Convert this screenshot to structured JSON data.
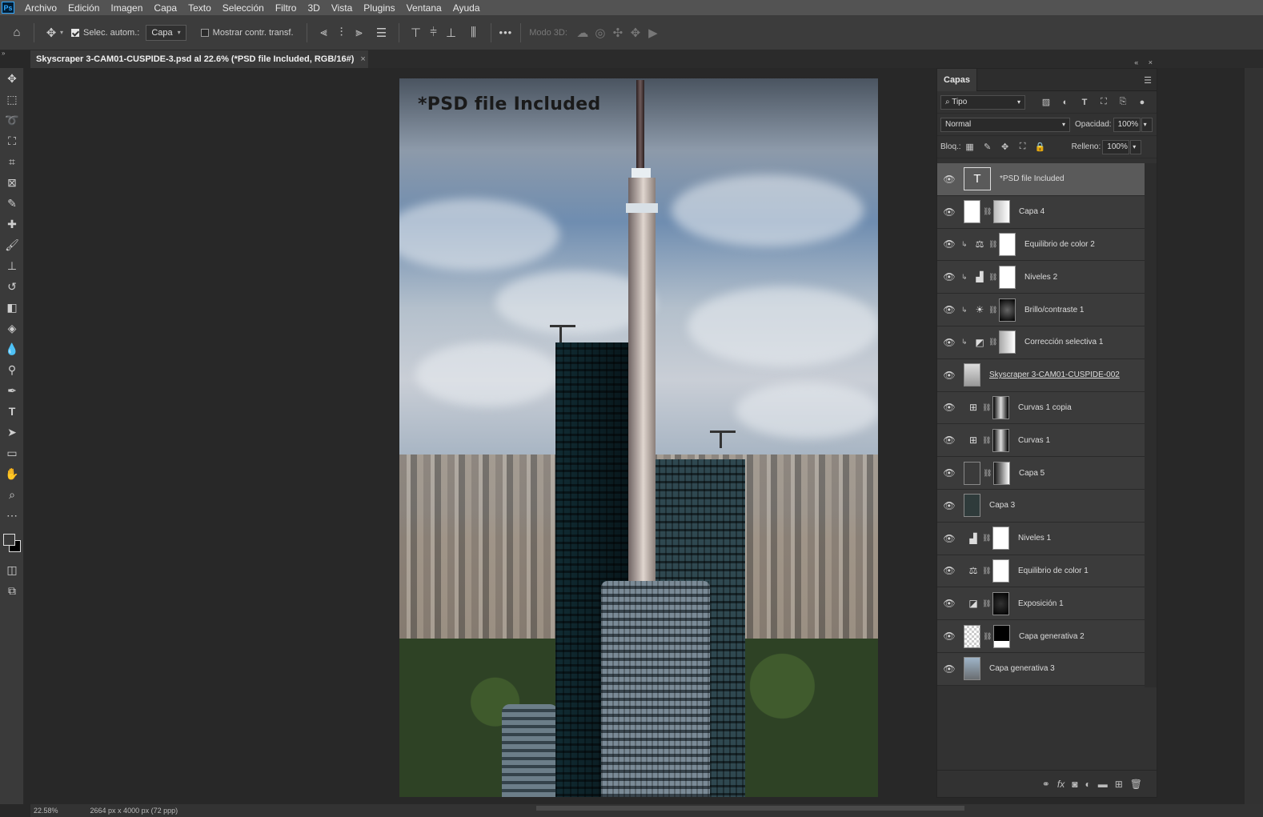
{
  "menubar": {
    "logo": "Ps",
    "items": [
      "Archivo",
      "Edición",
      "Imagen",
      "Capa",
      "Texto",
      "Selección",
      "Filtro",
      "3D",
      "Vista",
      "Plugins",
      "Ventana",
      "Ayuda"
    ]
  },
  "options": {
    "auto_select_label": "Selec. autom.:",
    "auto_select_target": "Capa",
    "show_transform_label": "Mostrar contr. transf.",
    "more_label": "•••",
    "mode3d_label": "Modo 3D:"
  },
  "document": {
    "tab_title": "Skyscraper 3-CAM01-CUSPIDE-3.psd al 22.6% (*PSD file Included, RGB/16#)",
    "canvas_text": "*PSD file Included"
  },
  "layers_panel": {
    "tab_label": "Capas",
    "filter_label": "Tipo",
    "blend_mode": "Normal",
    "opacity_label": "Opacidad:",
    "opacity_value": "100%",
    "lock_label": "Bloq.:",
    "fill_label": "Relleno:",
    "fill_value": "100%",
    "layers": [
      {
        "name": "*PSD file Included",
        "kind": "text",
        "selected": true
      },
      {
        "name": "Capa 4",
        "kind": "pixel-mask"
      },
      {
        "name": "Equilibrio de color 2",
        "kind": "adjust",
        "icon": "balance",
        "clip": true
      },
      {
        "name": "Niveles 2",
        "kind": "adjust",
        "icon": "levels",
        "clip": true
      },
      {
        "name": "Brillo/contraste 1",
        "kind": "adjust",
        "icon": "brightness",
        "clip": true
      },
      {
        "name": "Corrección selectiva 1",
        "kind": "adjust",
        "icon": "selective",
        "clip": true
      },
      {
        "name": "Skyscraper 3-CAM01-CUSPIDE-002",
        "kind": "smart"
      },
      {
        "name": "Curvas 1 copia",
        "kind": "adjust",
        "icon": "curves"
      },
      {
        "name": "Curvas 1",
        "kind": "adjust",
        "icon": "curves"
      },
      {
        "name": "Capa 5",
        "kind": "pixel-mask-dark"
      },
      {
        "name": "Capa 3",
        "kind": "pixel-dark"
      },
      {
        "name": "Niveles 1",
        "kind": "adjust",
        "icon": "levels"
      },
      {
        "name": "Equilibrio de color 1",
        "kind": "adjust",
        "icon": "balance"
      },
      {
        "name": "Exposición 1",
        "kind": "adjust",
        "icon": "exposure"
      },
      {
        "name": "Capa generativa 2",
        "kind": "generative"
      },
      {
        "name": "Capa generativa 3",
        "kind": "photo"
      }
    ]
  },
  "status": {
    "zoom": "22.58%",
    "dimensions": "2664 px x 4000 px (72 ppp)"
  }
}
